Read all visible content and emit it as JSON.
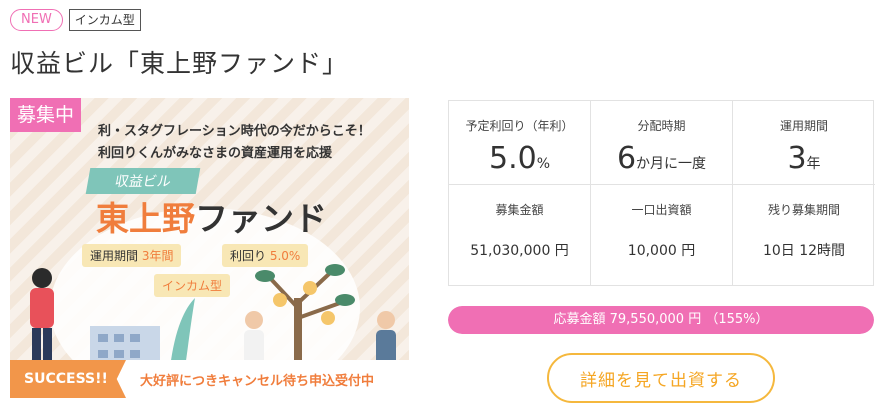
{
  "tags": {
    "new": "NEW",
    "type": "インカム型"
  },
  "title": "収益ビル「東上野ファンド」",
  "banner": {
    "badge": "募集中",
    "headline1": "利・スタグフレーション時代の今だからこそ！",
    "headline2": "利回りくんがみなさまの資産運用を応援",
    "ribbon": "収益ビル",
    "fund_name_a": "東上野",
    "fund_name_b": "ファンド",
    "pill_period_label": "運用期間",
    "pill_period_value": "3年間",
    "pill_yield_label": "利回り",
    "pill_yield_value": "5.0%",
    "pill_type": "インカム型",
    "success_label": "SUCCESS!!",
    "success_text": "大好評につきキャンセル待ち申込受付中"
  },
  "stats": {
    "yield_label": "予定利回り（年利）",
    "yield_value": "5.0",
    "yield_unit": "%",
    "dist_label": "分配時期",
    "dist_value": "6",
    "dist_unit": "か月に一度",
    "term_label": "運用期間",
    "term_value": "3",
    "term_unit": "年",
    "amount_label": "募集金額",
    "amount_value": "51,030,000 円",
    "unit_label": "一口出資額",
    "unit_value": "10,000 円",
    "remain_label": "残り募集期間",
    "remain_value": "10日 12時間"
  },
  "progress": {
    "text": "応募金額 79,550,000 円 （155%）",
    "percent": 155
  },
  "detail_button": "詳細を見て出資する",
  "colors": {
    "accent_pink": "#f06fb4",
    "accent_orange": "#f07d3c",
    "button_gold": "#f5b83d"
  }
}
